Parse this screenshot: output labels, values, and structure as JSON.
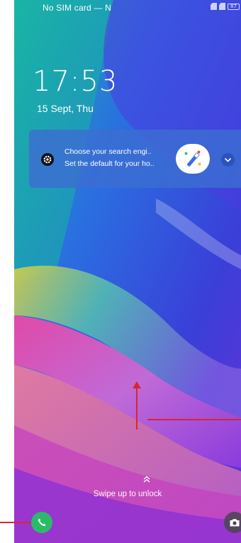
{
  "status_bar": {
    "carrier": "No SIM card — N",
    "battery_level": "87"
  },
  "lock_screen": {
    "time": "17:53",
    "date": "15 Sept, Thu"
  },
  "notification": {
    "title": "Choose your search engi..",
    "body": "Set the default for your ho.."
  },
  "unlock_hint": "Swipe up to unlock",
  "icons": {
    "settings": "settings-gear-icon",
    "app": "magic-wand-icon",
    "expand": "chevron-down-icon",
    "swipe": "double-chevron-up-icon",
    "phone": "phone-icon",
    "camera": "camera-icon"
  },
  "colors": {
    "phone_button": "#2bbb68",
    "annotation": "#d9262b"
  }
}
